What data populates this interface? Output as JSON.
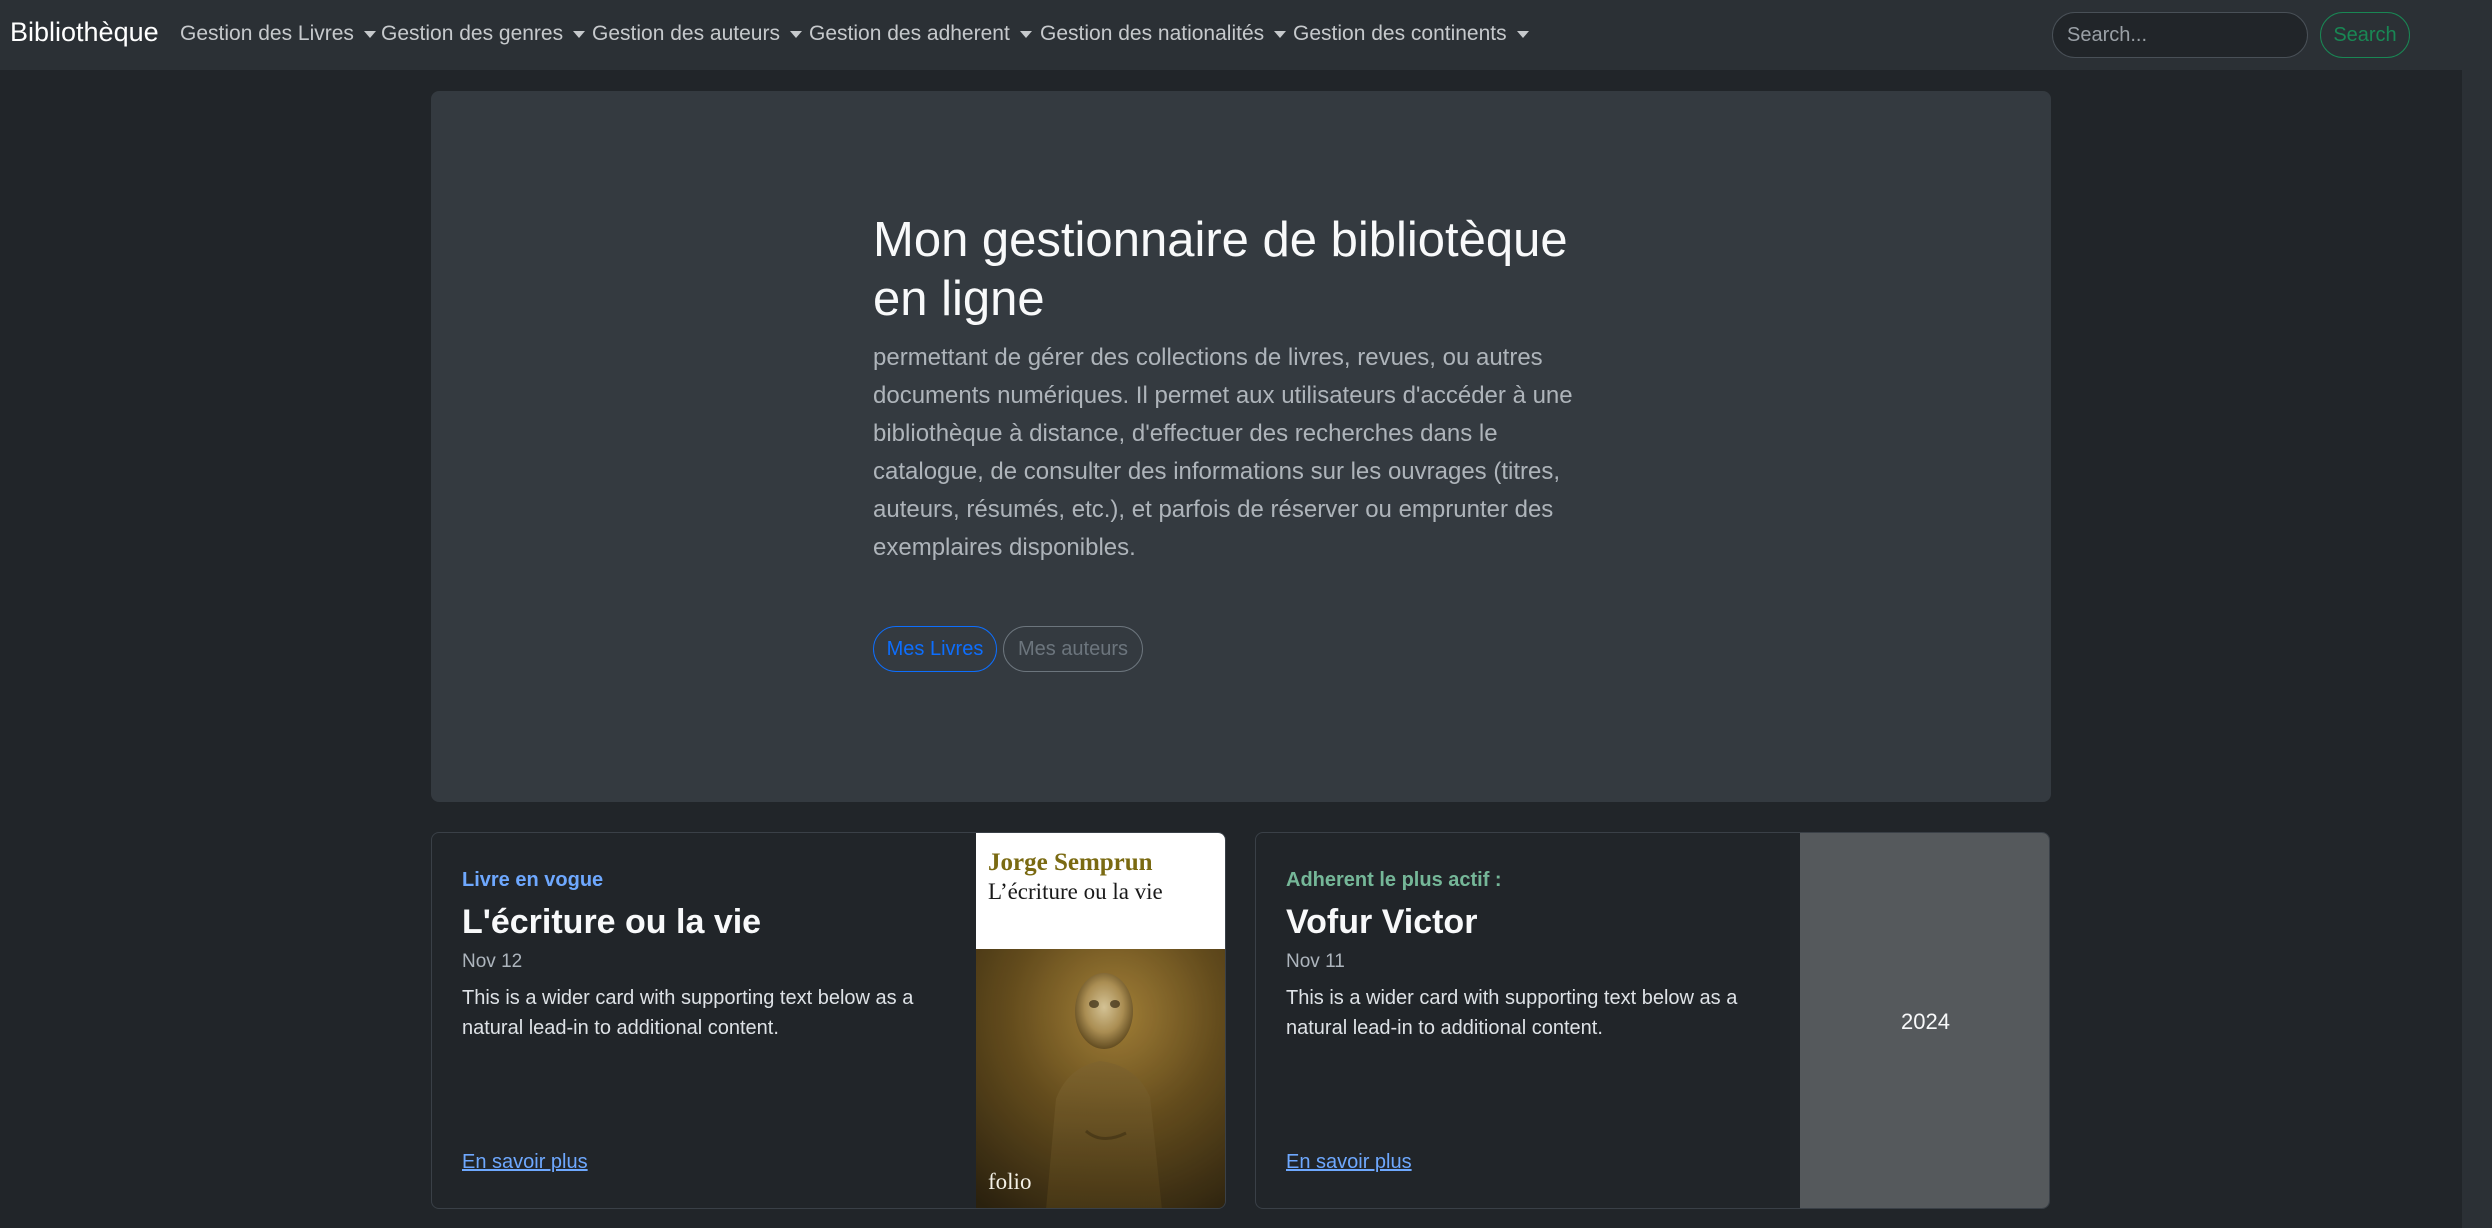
{
  "navbar": {
    "brand": "Bibliothèque",
    "menus": [
      {
        "label": "Gestion des Livres"
      },
      {
        "label": "Gestion des genres"
      },
      {
        "label": "Gestion des auteurs"
      },
      {
        "label": "Gestion des adherent"
      },
      {
        "label": "Gestion des nationalités"
      },
      {
        "label": "Gestion des continents"
      }
    ],
    "search": {
      "placeholder": "Search...",
      "value": "",
      "button_label": "Search"
    }
  },
  "hero": {
    "title": "Mon gestionnaire de bibliotèque en ligne",
    "lead": "permettant de gérer des collections de livres, revues, ou autres documents numériques. Il permet aux utilisateurs d'accéder à une bibliothèque à distance, d'effectuer des recherches dans le catalogue, de consulter des informations sur les ouvrages (titres, auteurs, résumés, etc.), et parfois de réserver ou emprunter des exemplaires disponibles.",
    "primary_button": "Mes Livres",
    "secondary_button": "Mes auteurs"
  },
  "cards": {
    "book": {
      "kicker": "Livre en vogue",
      "title": "L'écriture ou la vie",
      "date": "Nov 12",
      "text": "This is a wider card with supporting text below as a natural lead-in to additional content.",
      "link": "En savoir plus",
      "cover": {
        "author": "Jorge Semprun",
        "title": "L’écriture ou la vie",
        "publisher": "folio"
      }
    },
    "member": {
      "kicker": "Adherent le plus actif :",
      "title": "Vofur Victor",
      "date": "Nov 11",
      "text": "This is a wider card with supporting text below as a natural lead-in to additional content.",
      "link": "En savoir plus",
      "year": "2024"
    }
  },
  "colors": {
    "background": "#212529",
    "navbar": "#2b3035",
    "hero": "#343a40",
    "primary": "#0d6efd",
    "success": "#198754",
    "kicker_blue": "#6ea8fe",
    "kicker_green": "#75b798"
  }
}
